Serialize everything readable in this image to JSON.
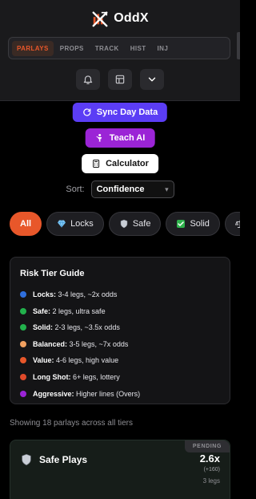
{
  "header": {
    "brand": "OddX",
    "tabs": [
      {
        "label": "PARLAYS",
        "active": true
      },
      {
        "label": "PROPS",
        "active": false
      },
      {
        "label": "TRACK",
        "active": false
      },
      {
        "label": "HIST",
        "active": false
      },
      {
        "label": "INJ",
        "active": false
      }
    ],
    "icons": [
      "bell-icon",
      "layout-icon",
      "chevron-down-icon"
    ]
  },
  "actions": {
    "sync_label": "Sync Day Data",
    "teach_label": "Teach AI",
    "calculator_label": "Calculator"
  },
  "sort": {
    "label": "Sort:",
    "selected": "Confidence"
  },
  "filters": [
    {
      "label": "All",
      "icon": "",
      "active": true
    },
    {
      "label": "Locks",
      "icon": "gem-icon",
      "active": false
    },
    {
      "label": "Safe",
      "icon": "shield-icon",
      "active": false
    },
    {
      "label": "Solid",
      "icon": "check-box-icon",
      "active": false
    },
    {
      "label": "",
      "icon": "scales-icon",
      "active": false
    }
  ],
  "risk_guide": {
    "title": "Risk Tier Guide",
    "tiers": [
      {
        "name": "Locks:",
        "desc": "3-4 legs, ~2x odds",
        "color": "#2f6fdd"
      },
      {
        "name": "Safe:",
        "desc": "2 legs, ultra safe",
        "color": "#22b14c"
      },
      {
        "name": "Solid:",
        "desc": "2-3 legs, ~3.5x odds",
        "color": "#22b14c"
      },
      {
        "name": "Balanced:",
        "desc": "3-5 legs, ~7x odds",
        "color": "#f0a060"
      },
      {
        "name": "Value:",
        "desc": "4-6 legs, high value",
        "color": "#e8572a"
      },
      {
        "name": "Long Shot:",
        "desc": "6+ legs, lottery",
        "color": "#e04a2a"
      },
      {
        "name": "Aggressive:",
        "desc": "Higher lines (Overs)",
        "color": "#9b24d6"
      }
    ]
  },
  "summary": "Showing 18 parlays across all tiers",
  "play_card": {
    "status": "PENDING",
    "title": "Safe Plays",
    "odds": "2.6x",
    "american": "(+160)",
    "legs": "3 legs"
  },
  "colors": {
    "accent": "#e8572a",
    "sync": "#5b3df5",
    "teach": "#9b24d6"
  }
}
